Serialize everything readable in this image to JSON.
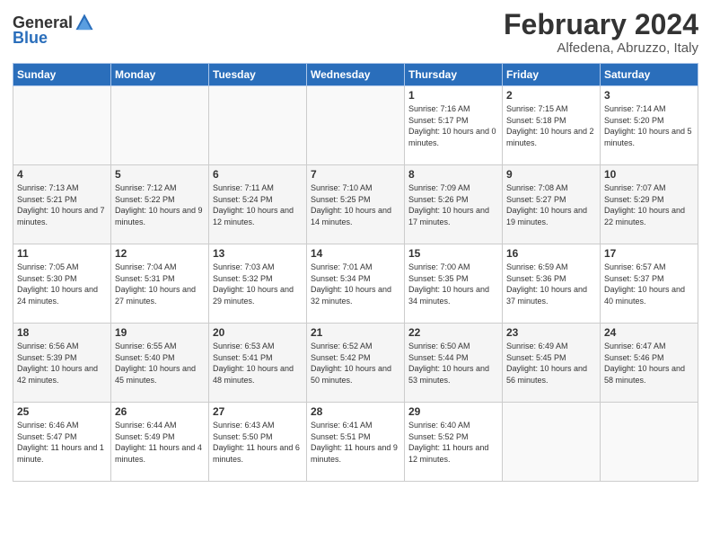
{
  "header": {
    "logo_general": "General",
    "logo_blue": "Blue",
    "title": "February 2024",
    "subtitle": "Alfedena, Abruzzo, Italy"
  },
  "days_of_week": [
    "Sunday",
    "Monday",
    "Tuesday",
    "Wednesday",
    "Thursday",
    "Friday",
    "Saturday"
  ],
  "weeks": [
    [
      {
        "day": "",
        "info": ""
      },
      {
        "day": "",
        "info": ""
      },
      {
        "day": "",
        "info": ""
      },
      {
        "day": "",
        "info": ""
      },
      {
        "day": "1",
        "info": "Sunrise: 7:16 AM\nSunset: 5:17 PM\nDaylight: 10 hours\nand 0 minutes."
      },
      {
        "day": "2",
        "info": "Sunrise: 7:15 AM\nSunset: 5:18 PM\nDaylight: 10 hours\nand 2 minutes."
      },
      {
        "day": "3",
        "info": "Sunrise: 7:14 AM\nSunset: 5:20 PM\nDaylight: 10 hours\nand 5 minutes."
      }
    ],
    [
      {
        "day": "4",
        "info": "Sunrise: 7:13 AM\nSunset: 5:21 PM\nDaylight: 10 hours\nand 7 minutes."
      },
      {
        "day": "5",
        "info": "Sunrise: 7:12 AM\nSunset: 5:22 PM\nDaylight: 10 hours\nand 9 minutes."
      },
      {
        "day": "6",
        "info": "Sunrise: 7:11 AM\nSunset: 5:24 PM\nDaylight: 10 hours\nand 12 minutes."
      },
      {
        "day": "7",
        "info": "Sunrise: 7:10 AM\nSunset: 5:25 PM\nDaylight: 10 hours\nand 14 minutes."
      },
      {
        "day": "8",
        "info": "Sunrise: 7:09 AM\nSunset: 5:26 PM\nDaylight: 10 hours\nand 17 minutes."
      },
      {
        "day": "9",
        "info": "Sunrise: 7:08 AM\nSunset: 5:27 PM\nDaylight: 10 hours\nand 19 minutes."
      },
      {
        "day": "10",
        "info": "Sunrise: 7:07 AM\nSunset: 5:29 PM\nDaylight: 10 hours\nand 22 minutes."
      }
    ],
    [
      {
        "day": "11",
        "info": "Sunrise: 7:05 AM\nSunset: 5:30 PM\nDaylight: 10 hours\nand 24 minutes."
      },
      {
        "day": "12",
        "info": "Sunrise: 7:04 AM\nSunset: 5:31 PM\nDaylight: 10 hours\nand 27 minutes."
      },
      {
        "day": "13",
        "info": "Sunrise: 7:03 AM\nSunset: 5:32 PM\nDaylight: 10 hours\nand 29 minutes."
      },
      {
        "day": "14",
        "info": "Sunrise: 7:01 AM\nSunset: 5:34 PM\nDaylight: 10 hours\nand 32 minutes."
      },
      {
        "day": "15",
        "info": "Sunrise: 7:00 AM\nSunset: 5:35 PM\nDaylight: 10 hours\nand 34 minutes."
      },
      {
        "day": "16",
        "info": "Sunrise: 6:59 AM\nSunset: 5:36 PM\nDaylight: 10 hours\nand 37 minutes."
      },
      {
        "day": "17",
        "info": "Sunrise: 6:57 AM\nSunset: 5:37 PM\nDaylight: 10 hours\nand 40 minutes."
      }
    ],
    [
      {
        "day": "18",
        "info": "Sunrise: 6:56 AM\nSunset: 5:39 PM\nDaylight: 10 hours\nand 42 minutes."
      },
      {
        "day": "19",
        "info": "Sunrise: 6:55 AM\nSunset: 5:40 PM\nDaylight: 10 hours\nand 45 minutes."
      },
      {
        "day": "20",
        "info": "Sunrise: 6:53 AM\nSunset: 5:41 PM\nDaylight: 10 hours\nand 48 minutes."
      },
      {
        "day": "21",
        "info": "Sunrise: 6:52 AM\nSunset: 5:42 PM\nDaylight: 10 hours\nand 50 minutes."
      },
      {
        "day": "22",
        "info": "Sunrise: 6:50 AM\nSunset: 5:44 PM\nDaylight: 10 hours\nand 53 minutes."
      },
      {
        "day": "23",
        "info": "Sunrise: 6:49 AM\nSunset: 5:45 PM\nDaylight: 10 hours\nand 56 minutes."
      },
      {
        "day": "24",
        "info": "Sunrise: 6:47 AM\nSunset: 5:46 PM\nDaylight: 10 hours\nand 58 minutes."
      }
    ],
    [
      {
        "day": "25",
        "info": "Sunrise: 6:46 AM\nSunset: 5:47 PM\nDaylight: 11 hours\nand 1 minute."
      },
      {
        "day": "26",
        "info": "Sunrise: 6:44 AM\nSunset: 5:49 PM\nDaylight: 11 hours\nand 4 minutes."
      },
      {
        "day": "27",
        "info": "Sunrise: 6:43 AM\nSunset: 5:50 PM\nDaylight: 11 hours\nand 6 minutes."
      },
      {
        "day": "28",
        "info": "Sunrise: 6:41 AM\nSunset: 5:51 PM\nDaylight: 11 hours\nand 9 minutes."
      },
      {
        "day": "29",
        "info": "Sunrise: 6:40 AM\nSunset: 5:52 PM\nDaylight: 11 hours\nand 12 minutes."
      },
      {
        "day": "",
        "info": ""
      },
      {
        "day": "",
        "info": ""
      }
    ]
  ]
}
